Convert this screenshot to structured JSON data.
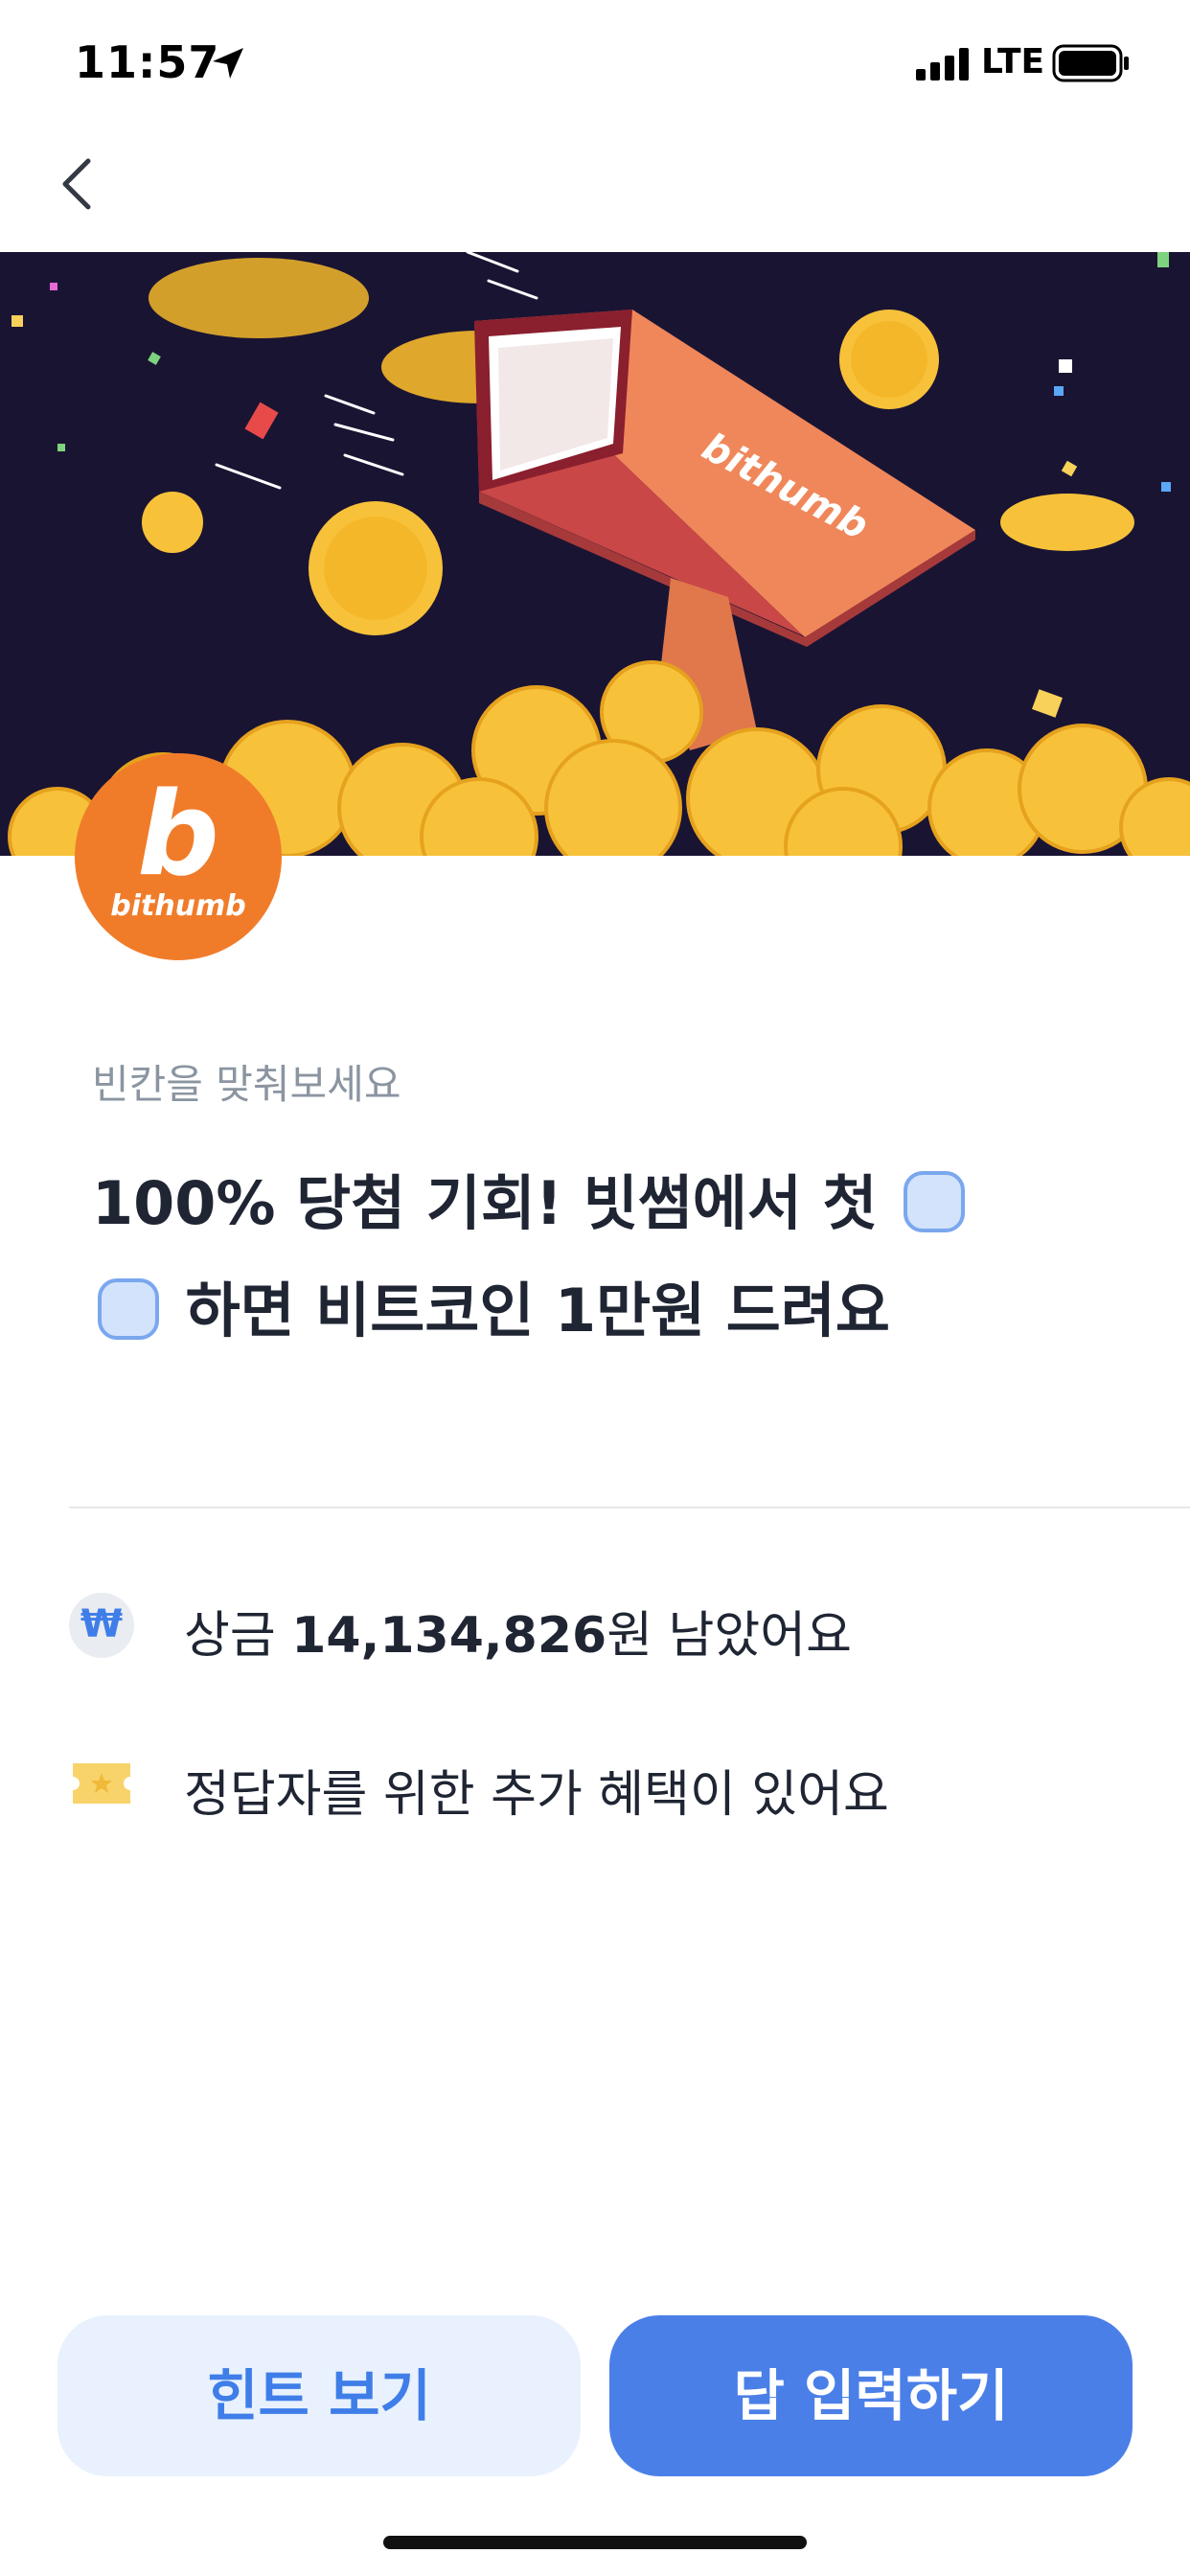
{
  "status_bar": {
    "time": "11:57",
    "network": "LTE"
  },
  "icons": {
    "back": "chevron-left-icon",
    "location": "location-arrow-icon",
    "signal": "signal-bars-icon",
    "battery": "battery-icon",
    "won": "won-icon",
    "ticket": "ticket-icon"
  },
  "hero": {
    "brand_on_gun": "bithumb"
  },
  "logo": {
    "mark": "b",
    "text": "bithumb",
    "color": "#f07c2a"
  },
  "quiz": {
    "subtitle": "빈칸을 맞춰보세요",
    "question_part1": "100% 당첨 기회! 빗썸에서 첫",
    "question_part2": "하면 비트코인 1만원 드려요"
  },
  "info": {
    "prize_prefix": "상금 ",
    "prize_amount": "14,134,826",
    "prize_suffix": "원 남았어요",
    "benefit": "정답자를 위한 추가 혜택이 있어요"
  },
  "buttons": {
    "hint": "힌트 보기",
    "answer": "답 입력하기"
  },
  "colors": {
    "accent": "#4b7fe8",
    "hint_bg": "#e8f1fd",
    "blank_fill": "#d2e3fb",
    "hero_bg": "#1a1433"
  }
}
